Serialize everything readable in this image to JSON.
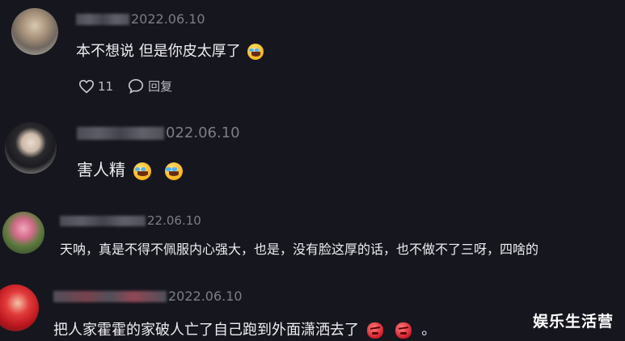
{
  "comments": [
    {
      "date": "2022.06.10",
      "text": "本不想说 但是你皮太厚了",
      "likes": "11",
      "reply_label": "回复"
    },
    {
      "date": "022.06.10",
      "text": "害人精"
    },
    {
      "date": "22.06.10",
      "text": "天呐，真是不得不佩服内心强大，也是，没有脸这厚的话，也不做不了三呀，四啥的"
    },
    {
      "date": "2022.06.10",
      "text": "把人家霍霍的家破人亡了自己跑到外面潇洒去了",
      "suffix": "。"
    }
  ],
  "watermark": "娱乐生活营",
  "icons": {
    "like": "heart-outline-icon",
    "reply": "speech-bubble-icon",
    "laugh_emoji": "laughing-tears-emoji-icon",
    "angry_emoji": "angry-face-emoji-icon"
  },
  "colors": {
    "background": "#16161e",
    "text": "#ececf0",
    "meta": "#7d7d88"
  }
}
